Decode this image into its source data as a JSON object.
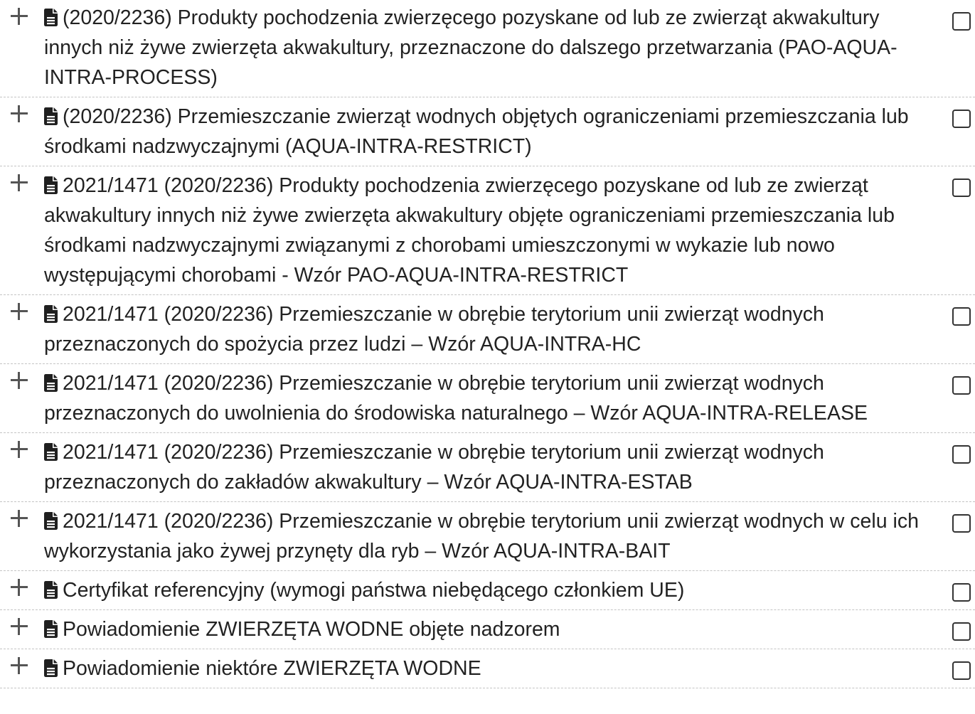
{
  "icons": {
    "expand": "plus-icon",
    "document": "file-text-icon"
  },
  "colors": {
    "text": "#222222",
    "separator": "#c4c4c4"
  },
  "items": [
    {
      "label": "(2020/2236) Produkty pochodzenia zwierzęcego pozyskane od lub ze zwierząt akwakultury innych niż żywe zwierzęta akwakultury, przeznaczone do dalszego przetwarzania (PAO-AQUA-INTRA-PROCESS)",
      "checked": false
    },
    {
      "label": "(2020/2236) Przemieszczanie zwierząt wodnych objętych ograniczeniami przemieszczania lub środkami nadzwyczajnymi (AQUA-INTRA-RESTRICT)",
      "checked": false
    },
    {
      "label": "2021/1471 (2020/2236) Produkty pochodzenia zwierzęcego pozyskane od lub ze zwierząt akwakultury innych niż żywe zwierzęta akwakultury objęte ograniczeniami przemieszczania lub środkami nadzwyczajnymi związanymi z chorobami umieszczonymi w wykazie lub nowo występującymi chorobami - Wzór PAO-AQUA-INTRA-RESTRICT",
      "checked": false
    },
    {
      "label": "2021/1471 (2020/2236) Przemieszczanie w obrębie terytorium unii zwierząt wodnych przeznaczonych do spożycia przez ludzi – Wzór AQUA-INTRA-HC",
      "checked": false
    },
    {
      "label": "2021/1471 (2020/2236) Przemieszczanie w obrębie terytorium unii zwierząt wodnych przeznaczonych do uwolnienia do środowiska naturalnego – Wzór AQUA-INTRA-RELEASE",
      "checked": false
    },
    {
      "label": "2021/1471 (2020/2236) Przemieszczanie w obrębie terytorium unii zwierząt wodnych przeznaczonych do zakładów akwakultury – Wzór AQUA-INTRA-ESTAB",
      "checked": false
    },
    {
      "label": "2021/1471 (2020/2236) Przemieszczanie w obrębie terytorium unii zwierząt wodnych w celu ich wykorzystania jako żywej przynęty dla ryb – Wzór AQUA-INTRA-BAIT",
      "checked": false
    },
    {
      "label": "Certyfikat referencyjny (wymogi państwa niebędącego członkiem UE)",
      "checked": false
    },
    {
      "label": "Powiadomienie ZWIERZĘTA WODNE objęte nadzorem",
      "checked": false
    },
    {
      "label": "Powiadomienie niektóre ZWIERZĘTA WODNE",
      "checked": false
    }
  ]
}
